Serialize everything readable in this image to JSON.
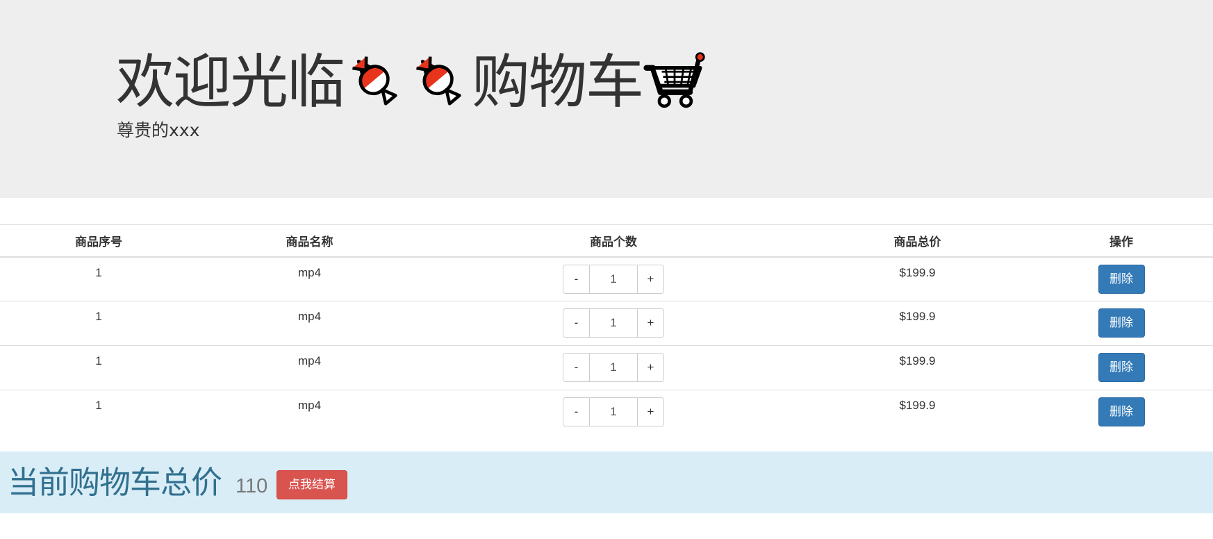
{
  "header": {
    "title_prefix": "欢迎光临",
    "title_suffix": "购物车",
    "subtitle": "尊贵的xxx",
    "emojis": [
      "candy-icon",
      "candy-icon",
      "shopping-cart-icon"
    ]
  },
  "table": {
    "columns": [
      "商品序号",
      "商品名称",
      "商品个数",
      "商品总价",
      "操作"
    ],
    "rows": [
      {
        "id": "1",
        "name": "mp4",
        "qty": "1",
        "total": "$199.9",
        "action": "删除"
      },
      {
        "id": "1",
        "name": "mp4",
        "qty": "1",
        "total": "$199.9",
        "action": "删除"
      },
      {
        "id": "1",
        "name": "mp4",
        "qty": "1",
        "total": "$199.9",
        "action": "删除"
      },
      {
        "id": "1",
        "name": "mp4",
        "qty": "1",
        "total": "$199.9",
        "action": "删除"
      }
    ],
    "minus_label": "-",
    "plus_label": "+"
  },
  "summary": {
    "title": "当前购物车总价",
    "total": "110",
    "checkout_label": "点我结算"
  },
  "colors": {
    "primary": "#337ab7",
    "danger": "#d9534f",
    "info_bg": "#d9edf7",
    "info_text": "#31708f",
    "jumbotron_bg": "#eeeeee"
  }
}
